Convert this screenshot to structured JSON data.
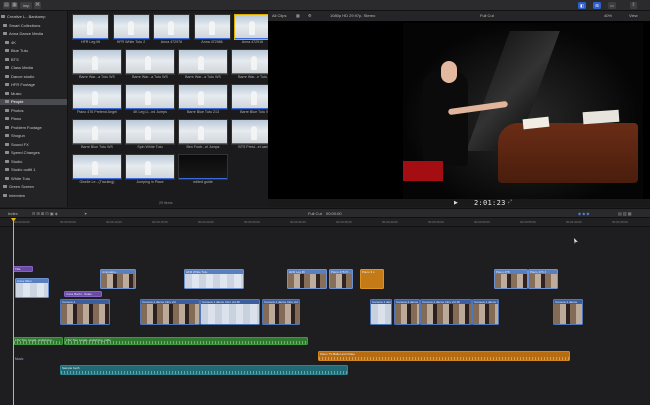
{
  "toolbar": {
    "import_label": "Imp",
    "view_left": "◧",
    "view_mid": "⊞",
    "view_right": "▭"
  },
  "sidebar": {
    "items": [
      {
        "label": "Creative L...Bankamp",
        "sel": false
      },
      {
        "label": "Smart Collections",
        "sel": false
      },
      {
        "label": "Anna Dance Media",
        "sel": false
      },
      {
        "label": "4K",
        "sel": false
      },
      {
        "label": "Blue Tutu",
        "sel": false
      },
      {
        "label": "BTS",
        "sel": false
      },
      {
        "label": "Class Media",
        "sel": false
      },
      {
        "label": "Dance studio",
        "sel": false
      },
      {
        "label": "HFR Footage",
        "sel": false
      },
      {
        "label": "Music",
        "sel": false
      },
      {
        "label": "People",
        "sel": true
      },
      {
        "label": "Photos",
        "sel": false
      },
      {
        "label": "Piano",
        "sel": false
      },
      {
        "label": "Problem Footage",
        "sel": false
      },
      {
        "label": "Shogun",
        "sel": false
      },
      {
        "label": "Sound FX",
        "sel": false
      },
      {
        "label": "Speed Changes",
        "sel": false
      },
      {
        "label": "Studio",
        "sel": false
      },
      {
        "label": "Studio outfit 1",
        "sel": false
      },
      {
        "label": "White Tutu",
        "sel": false
      },
      {
        "label": "Green Screen",
        "sel": false
      },
      {
        "label": "Interview",
        "sel": false
      }
    ]
  },
  "browser": {
    "items_count": "29 items",
    "clips": [
      {
        "label": "HFR Leg lift",
        "dark": false,
        "sel": false
      },
      {
        "label": "HFR White Tutu 2",
        "dark": false,
        "sel": false
      },
      {
        "label": "Anna 472976",
        "dark": false,
        "sel": false
      },
      {
        "label": "Anna 472986",
        "dark": false,
        "sel": false
      },
      {
        "label": "Anna 472916",
        "dark": false,
        "sel": true
      },
      {
        "label": "Barre War...a Tutu WS",
        "dark": false,
        "sel": false
      },
      {
        "label": "Barre War...a Tutu WS",
        "dark": false,
        "sel": false
      },
      {
        "label": "Barre War...a Tutu WS",
        "dark": false,
        "sel": false
      },
      {
        "label": "Barre War...e Tutu WS",
        "dark": false,
        "sel": false
      },
      {
        "label": "Piano 476 Pretend Angel",
        "dark": false,
        "sel": false
      },
      {
        "label": "4K Leg Li...nd Jumps",
        "dark": false,
        "sel": false
      },
      {
        "label": "Barre Blue Tutu 213",
        "dark": false,
        "sel": false
      },
      {
        "label": "Barre Blue Tutu WS",
        "dark": false,
        "sel": false
      },
      {
        "label": "Barre Blue Tutu WS",
        "dark": false,
        "sel": false
      },
      {
        "label": "Spin White Tutu",
        "dark": false,
        "sel": false
      },
      {
        "label": "Ben Footr...el Jumps",
        "dark": false,
        "sel": false
      },
      {
        "label": "BTS Prest...el camera",
        "dark": false,
        "sel": false
      },
      {
        "label": "Giselle Le...(Tracking)",
        "dark": false,
        "sel": false
      },
      {
        "label": "Jumping in Place",
        "dark": false,
        "sel": false
      },
      {
        "label": "edited guide",
        "dark": true,
        "sel": false
      }
    ]
  },
  "viewer": {
    "all_clips": "All Clips",
    "format": "1080p HD 29.97p, Stereo",
    "project": "Full Cut",
    "zoom": "40%",
    "view": "View",
    "timecode": "2:01:23"
  },
  "timeline": {
    "index": "Index",
    "project": "Full Cut",
    "duration": "00:00:00",
    "ruler_ticks": [
      "00:00:00:00",
      "00:00:05:00",
      "00:00:10:00",
      "00:00:15:00",
      "00:00:20:00",
      "00:00:25:00",
      "00:00:30:00",
      "00:00:35:00",
      "00:00:40:00",
      "00:00:45:00",
      "00:00:50:00",
      "00:00:55:00",
      "00:01:00:00",
      "00:01:05:00"
    ],
    "clips": {
      "title1": "Title",
      "top1": "Anna Wam",
      "top2": "Amputatio...",
      "top3": "HFR White Tutu",
      "top4": "HFR Leg lift",
      "top5": "Piano 476 Pr...",
      "top6": "Piano 476 J",
      "top7": "Piano 478",
      "top8": "Piano 4..",
      "gen1": "Piano 3 s",
      "title2": "Anna Rochi - Scale",
      "prim1": "Camera 1",
      "prim2": "Camera 1 dance Intro vid",
      "prim3": "Camera 1 dance Intro vid 4K",
      "prim4": "Camera 1 dance Intro vid 4K",
      "prim5": "Camera 1 dance Intro",
      "prim6": "Camera 4 dance",
      "prim7": "Camera 1 dance Intro vid 4K",
      "prim8": "Camera 1",
      "prim9": "Camera 1 dance",
      "prim10": "Camera 1 dance Intro",
      "lane_music": "Music",
      "aud1": "LSV Tom Lingel- underlying ...",
      "aud2": "LSV Tom Lingel- underlying_indie",
      "aud3": "Piano TV-Ballet and Video",
      "aud4": "Sample footh"
    }
  }
}
